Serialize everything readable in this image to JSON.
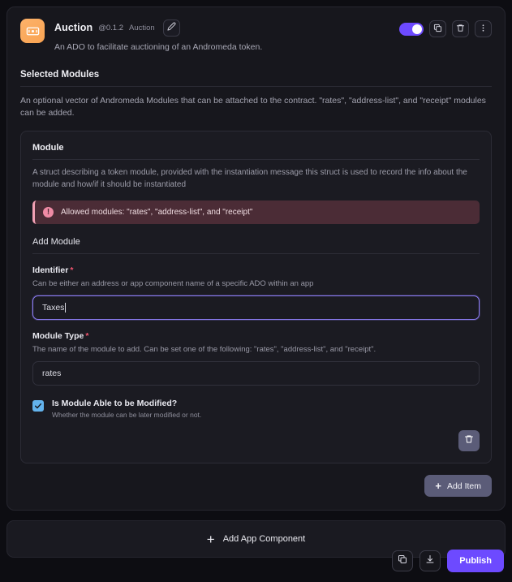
{
  "ado": {
    "icon": "banknote-icon",
    "name": "Auction",
    "version": "@0.1.2",
    "type_label": "Auction",
    "description": "An ADO to facilitate auctioning of an Andromeda token.",
    "edit_icon": "pencil-icon",
    "toggle_enabled": true,
    "copy_icon": "copy-icon",
    "delete_icon": "trash-icon",
    "more_icon": "kebab-menu-icon"
  },
  "section": {
    "title": "Selected Modules",
    "description": "An optional vector of Andromeda Modules that can be attached to the contract. \"rates\", \"address-list\", and \"receipt\" modules can be added."
  },
  "module": {
    "title": "Module",
    "description": "A struct describing a token module, provided with the instantiation message this struct is used to record the info about the module and how/if it should be instantiated",
    "alert": {
      "icon": "alert-exclamation-icon",
      "text": "Allowed modules: \"rates\", \"address-list\", and \"receipt\"",
      "accent_color": "#f2a0b4",
      "bg_color": "#4b2c36"
    },
    "add_module_title": "Add Module",
    "identifier": {
      "label": "Identifier",
      "required_marker": "*",
      "help": "Can be either an address or app component name of a specific ADO within an app",
      "value": "Taxes",
      "placeholder": "",
      "focused": true
    },
    "module_type": {
      "label": "Module Type",
      "required_marker": "*",
      "help": "The name of the module to add. Can be set one of the following: \"rates\", \"address-list\", and \"receipt\".",
      "value": "rates",
      "placeholder": ""
    },
    "modifiable": {
      "label": "Is Module Able to be Modified?",
      "help": "Whether the module can be later modified or not.",
      "checked": true,
      "check_color": "#63b3ed"
    },
    "delete_icon": "trash-icon"
  },
  "add_item": {
    "label": "Add Item",
    "icon": "plus-icon"
  },
  "add_app_component": {
    "label": "Add App Component",
    "icon": "plus-icon"
  },
  "bottom_bar": {
    "copy_icon": "copy-icon",
    "download_icon": "download-icon",
    "publish_label": "Publish",
    "publish_color": "#6d4aff"
  }
}
